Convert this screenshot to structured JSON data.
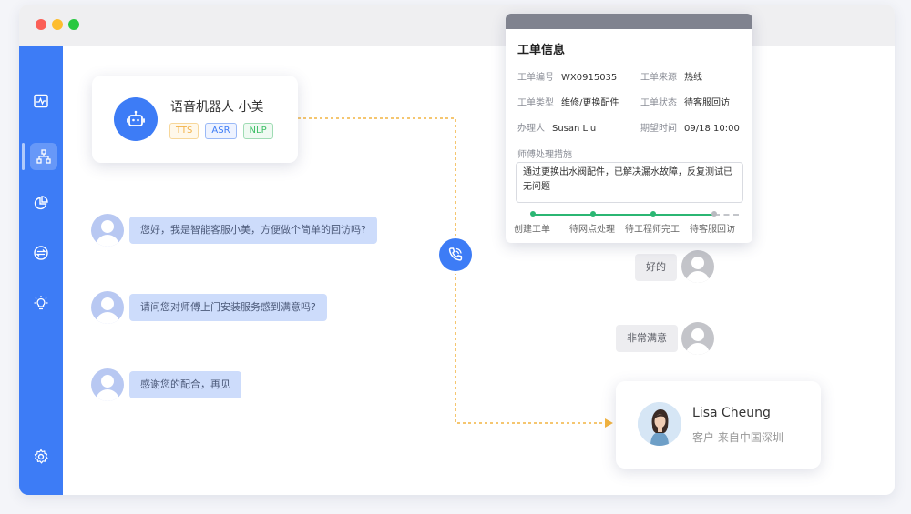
{
  "colors": {
    "accent": "#3d7cf6",
    "success": "#2bb673",
    "dashed_connector": "#f2b440"
  },
  "sidebar": {
    "items": [
      {
        "name": "monitor-icon",
        "active": false
      },
      {
        "name": "org-chart-icon",
        "active": true
      },
      {
        "name": "pie-chart-icon",
        "active": false
      },
      {
        "name": "exchange-icon",
        "active": false
      },
      {
        "name": "lightbulb-icon",
        "active": false
      },
      {
        "name": "gear-icon",
        "active": false
      }
    ]
  },
  "bot": {
    "name": "语音机器人  小美",
    "tags": [
      "TTS",
      "ASR",
      "NLP"
    ],
    "icon": "robot-icon"
  },
  "conversation": {
    "bot_messages": [
      "您好，我是智能客服小美，方便做个简单的回访吗?",
      "请问您对师傅上门安装服务感到满意吗?",
      "感谢您的配合，再见"
    ],
    "customer_replies": [
      "好的",
      "非常满意"
    ]
  },
  "call_icon": "phone-icon",
  "ticket": {
    "title": "工单信息",
    "fields": [
      {
        "label": "工单编号",
        "value": "WX0915035"
      },
      {
        "label": "工单来源",
        "value": "热线"
      },
      {
        "label": "工单类型",
        "value": "维修/更换配件"
      },
      {
        "label": "工单状态",
        "value": "待客服回访"
      },
      {
        "label": "办理人",
        "value": "Susan Liu"
      },
      {
        "label": "期望时间",
        "value": "09/18 10:00"
      }
    ],
    "measures_label": "师傅处理措施",
    "measures_text": "通过更换出水阀配件，已解决漏水故障，反复测试已无问题",
    "progress": {
      "steps": [
        "创建工单",
        "待网点处理",
        "待工程师完工",
        "待客服回访"
      ],
      "completed": 3
    }
  },
  "customer": {
    "name": "Lisa Cheung",
    "subtitle": "客户 来自中国深圳"
  }
}
